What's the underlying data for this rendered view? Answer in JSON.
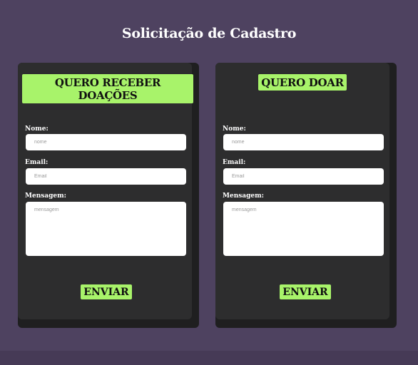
{
  "page": {
    "title": "Solicitação de Cadastro"
  },
  "forms": [
    {
      "title": "QUERO RECEBER DOAÇÕES",
      "name_label": "Nome:",
      "name_placeholder": "nome",
      "email_label": "Email:",
      "email_placeholder": "Email",
      "message_label": "Mensagem:",
      "message_placeholder": "mensagem",
      "submit_label": "ENVIAR"
    },
    {
      "title": "QUERO DOAR",
      "name_label": "Nome:",
      "name_placeholder": "nome",
      "email_label": "Email:",
      "email_placeholder": "Email",
      "message_label": "Mensagem:",
      "message_placeholder": "mensagem",
      "submit_label": "ENVIAR"
    }
  ],
  "colors": {
    "background": "#4e4260",
    "card": "#2d2d2e",
    "accent": "#a8f36a"
  }
}
